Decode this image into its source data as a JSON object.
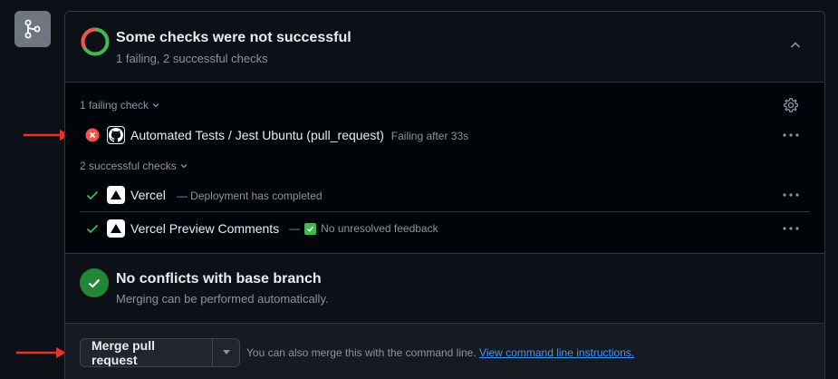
{
  "checks_header": {
    "title": "Some checks were not successful",
    "subtitle": "1 failing, 2 successful checks"
  },
  "failing_section": {
    "label": "1 failing check",
    "items": [
      {
        "name": "Automated Tests / Jest Ubuntu (pull_request)",
        "description": "Failing after 33s",
        "status": "failing",
        "logo": "github-icon"
      }
    ]
  },
  "successful_section": {
    "label": "2 successful checks",
    "items": [
      {
        "name": "Vercel",
        "description": "— Deployment has completed",
        "status": "success",
        "logo": "vercel-icon"
      },
      {
        "name": "Vercel Preview Comments",
        "description_prefix": "—",
        "description": "No unresolved feedback",
        "status": "success",
        "logo": "vercel-icon"
      }
    ]
  },
  "conflicts": {
    "title": "No conflicts with base branch",
    "subtitle": "Merging can be performed automatically."
  },
  "merge": {
    "button_label": "Merge pull request",
    "hint_text": "You can also merge this with the command line.",
    "hint_link": "View command line instructions."
  },
  "colors": {
    "success": "#3fb950",
    "failure": "#f85149",
    "link": "#4493f8",
    "annotation_arrow": "#e5322d"
  }
}
